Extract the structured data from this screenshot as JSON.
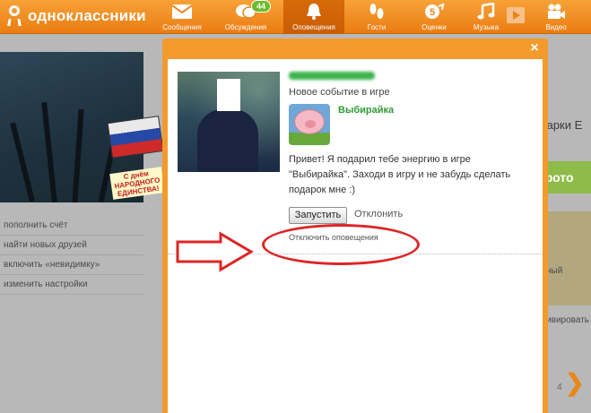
{
  "header": {
    "site_name": "одноклассники",
    "nav": [
      {
        "label": "Сообщения",
        "icon": "envelope-icon"
      },
      {
        "label": "Обсуждения",
        "icon": "chat-bubbles-icon",
        "badge": "44"
      },
      {
        "label": "Оповещения",
        "icon": "bell-icon",
        "active": true
      },
      {
        "label": "Гости",
        "icon": "footprints-icon"
      },
      {
        "label": "Оценки",
        "icon": "rating-icon"
      },
      {
        "label": "Музыка",
        "icon": "music-note-icon"
      },
      {
        "label": "Видео",
        "icon": "video-camera-icon"
      }
    ]
  },
  "sidebar": {
    "postcard_text": "С днём НАРОДНОГО ЕДИНСТВА!",
    "menu": [
      "пополнить счёт",
      "найти новых друзей",
      "включить «невидимку»",
      "изменить настройки"
    ]
  },
  "background_right": {
    "link_partial": "дарки Е",
    "button_partial": "фото",
    "text_partial_1": "ный",
    "text_partial_2": "ктивировать",
    "pager_number": "4"
  },
  "notification": {
    "close_symbol": "×",
    "event_title": "Новое событие в игре",
    "game_name": "Выбирайка",
    "message": "Привет! Я подарил тебе энергию в игре \"Выбирайка\". Заходи в игру и не забудь сделать подарок мне :)",
    "launch_label": "Запустить",
    "decline_label": "Отклонить",
    "disable_label": "Отключить оповещения"
  },
  "colors": {
    "brand_orange": "#f29a2b",
    "badge_green": "#6cbc2c",
    "annotation_red": "#dc2626",
    "game_link_green": "#2f9c35"
  }
}
